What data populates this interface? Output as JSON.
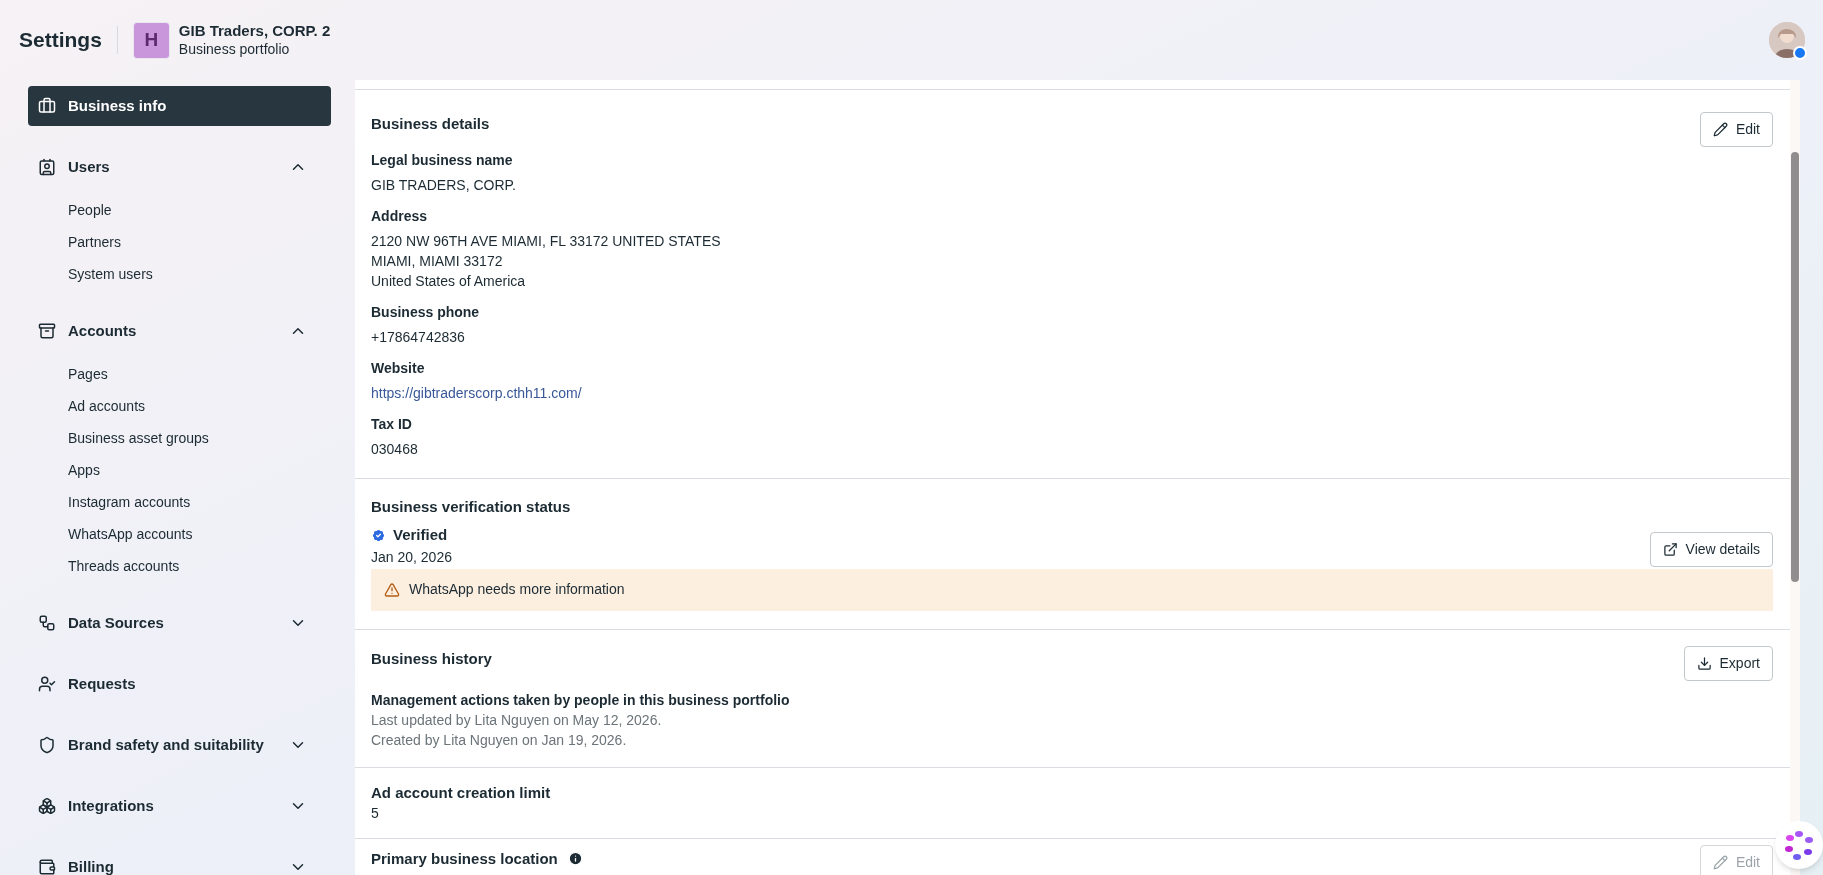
{
  "header": {
    "title": "Settings",
    "portfolio": {
      "initial": "H",
      "name": "GIB Traders, CORP. 2",
      "subtitle": "Business portfolio"
    }
  },
  "sidebar": {
    "items": [
      {
        "kind": "link",
        "label": "Business info",
        "selected": true
      },
      {
        "kind": "group",
        "label": "Users",
        "selected": false,
        "expanded": true,
        "children": [
          {
            "label": "People",
            "selected": false
          },
          {
            "label": "Partners",
            "selected": false
          },
          {
            "label": "System users",
            "selected": false
          }
        ]
      },
      {
        "kind": "group",
        "label": "Accounts",
        "selected": false,
        "expanded": true,
        "children": [
          {
            "label": "Pages",
            "selected": false
          },
          {
            "label": "Ad accounts",
            "selected": false
          },
          {
            "label": "Business asset groups",
            "selected": false
          },
          {
            "label": "Apps",
            "selected": false
          },
          {
            "label": "Instagram accounts",
            "selected": false
          },
          {
            "label": "WhatsApp accounts",
            "selected": false
          },
          {
            "label": "Threads accounts",
            "selected": false
          }
        ]
      },
      {
        "kind": "group",
        "label": "Data Sources",
        "selected": false,
        "expanded": false
      },
      {
        "kind": "link",
        "label": "Requests",
        "selected": false
      },
      {
        "kind": "group",
        "label": "Brand safety and suitability",
        "selected": false,
        "expanded": false
      },
      {
        "kind": "group",
        "label": "Integrations",
        "selected": false,
        "expanded": false
      },
      {
        "kind": "group",
        "label": "Billing",
        "selected": false,
        "expanded": false
      }
    ]
  },
  "sections": [
    {
      "kind": "details",
      "title": "Business details",
      "button": {
        "label": "Edit",
        "disabled": false
      },
      "fields": [
        {
          "label": "Legal business name",
          "kind": "text",
          "lines": [
            "GIB TRADERS, CORP."
          ]
        },
        {
          "label": "Address",
          "kind": "text",
          "lines": [
            "2120 NW 96TH AVE MIAMI, FL 33172 UNITED STATES",
            "MIAMI, MIAMI 33172",
            "United States of America"
          ]
        },
        {
          "label": "Business phone",
          "kind": "text",
          "lines": [
            "+17864742836"
          ]
        },
        {
          "label": "Website",
          "kind": "link",
          "lines": [
            "https://gibtraderscorp.cthh11.com/"
          ]
        },
        {
          "label": "Tax ID",
          "kind": "text",
          "lines": [
            "030468"
          ]
        }
      ]
    },
    {
      "kind": "verification",
      "title": "Business verification status",
      "status": "Verified",
      "verified": true,
      "date": "Jan 20, 2026",
      "warning": "WhatsApp needs more information",
      "button": {
        "label": "View details",
        "disabled": false
      }
    },
    {
      "kind": "history",
      "title": "Business history",
      "button": {
        "label": "Export",
        "disabled": false
      },
      "subtitle": "Management actions taken by people in this business portfolio",
      "lines": [
        "Last updated by Lita Nguyen on May 12, 2026.",
        "Created by Lita Nguyen on Jan 19, 2026."
      ]
    },
    {
      "kind": "value",
      "title": "Ad account creation limit",
      "value": "5"
    },
    {
      "kind": "location",
      "title": "Primary business location",
      "button": {
        "label": "Edit",
        "disabled": true
      }
    }
  ]
}
